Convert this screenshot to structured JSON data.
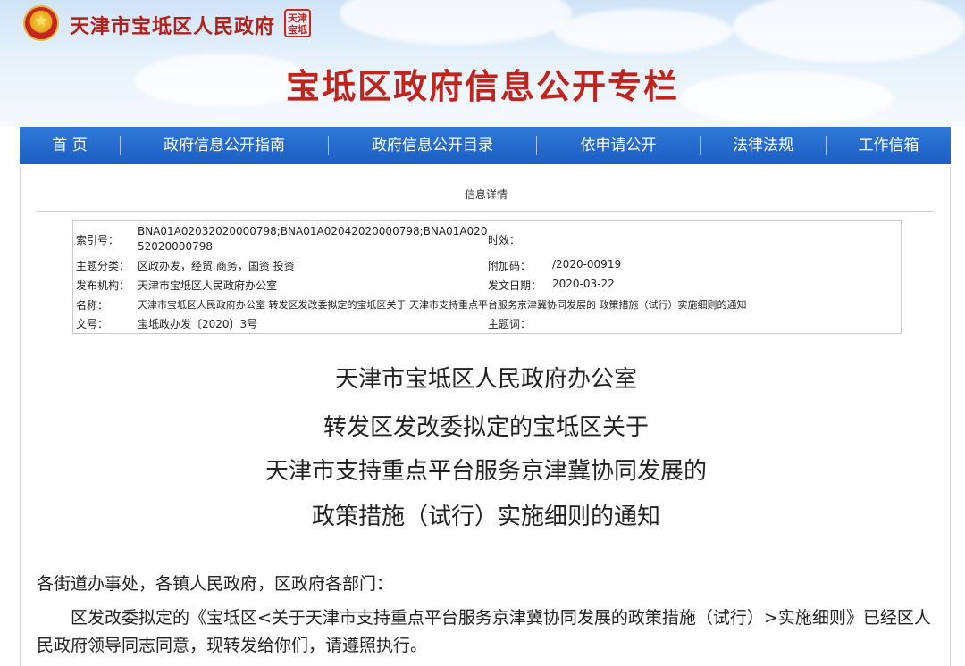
{
  "header": {
    "gov_name": "天津市宝坻区人民政府",
    "seal_text": "天津宝坻",
    "column_title": "宝坻区政府信息公开专栏"
  },
  "nav": {
    "items": [
      "首 页",
      "政府信息公开指南",
      "政府信息公开目录",
      "依申请公开",
      "法律法规",
      "工作信箱"
    ]
  },
  "detail": {
    "title": "信息详情"
  },
  "info": {
    "index_label": "索引号：",
    "index_value": "BNA01A02032020000798;BNA01A02042020000798;BNA01A02052020000798",
    "validity_label": "时效：",
    "validity_value": "",
    "category_label": "主题分类：",
    "category_value": "区政办发，经贸 商务，国资 投资",
    "extra_code_label": "附加码：",
    "extra_code_value": "/2020-00919",
    "publisher_label": "发布机构：",
    "publisher_value": "天津市宝坻区人民政府办公室",
    "date_label": "发文日期：",
    "date_value": "2020-03-22",
    "name_label": "名称：",
    "name_value": "天津市宝坻区人民政府办公室 转发区发改委拟定的宝坻区关于 天津市支持重点平台服务京津冀协同发展的 政策措施（试行）实施细则的通知",
    "docno_label": "文号：",
    "docno_value": "宝坻政办发〔2020〕3号",
    "keyword_label": "主题词：",
    "keyword_value": ""
  },
  "document": {
    "title_lines": [
      "天津市宝坻区人民政府办公室",
      "转发区发改委拟定的宝坻区关于",
      "天津市支持重点平台服务京津冀协同发展的",
      "政策措施（试行）实施细则的通知"
    ],
    "salutation": "各街道办事处，各镇人民政府，区政府各部门：",
    "body": "区发改委拟定的《宝坻区<关于天津市支持重点平台服务京津冀协同发展的政策措施（试行）>实施细则》已经区人民政府领导同志同意，现转发给你们，请遵照执行。"
  },
  "colors": {
    "brand_red": "#c0251d",
    "nav_blue": "#1d5ec2"
  }
}
